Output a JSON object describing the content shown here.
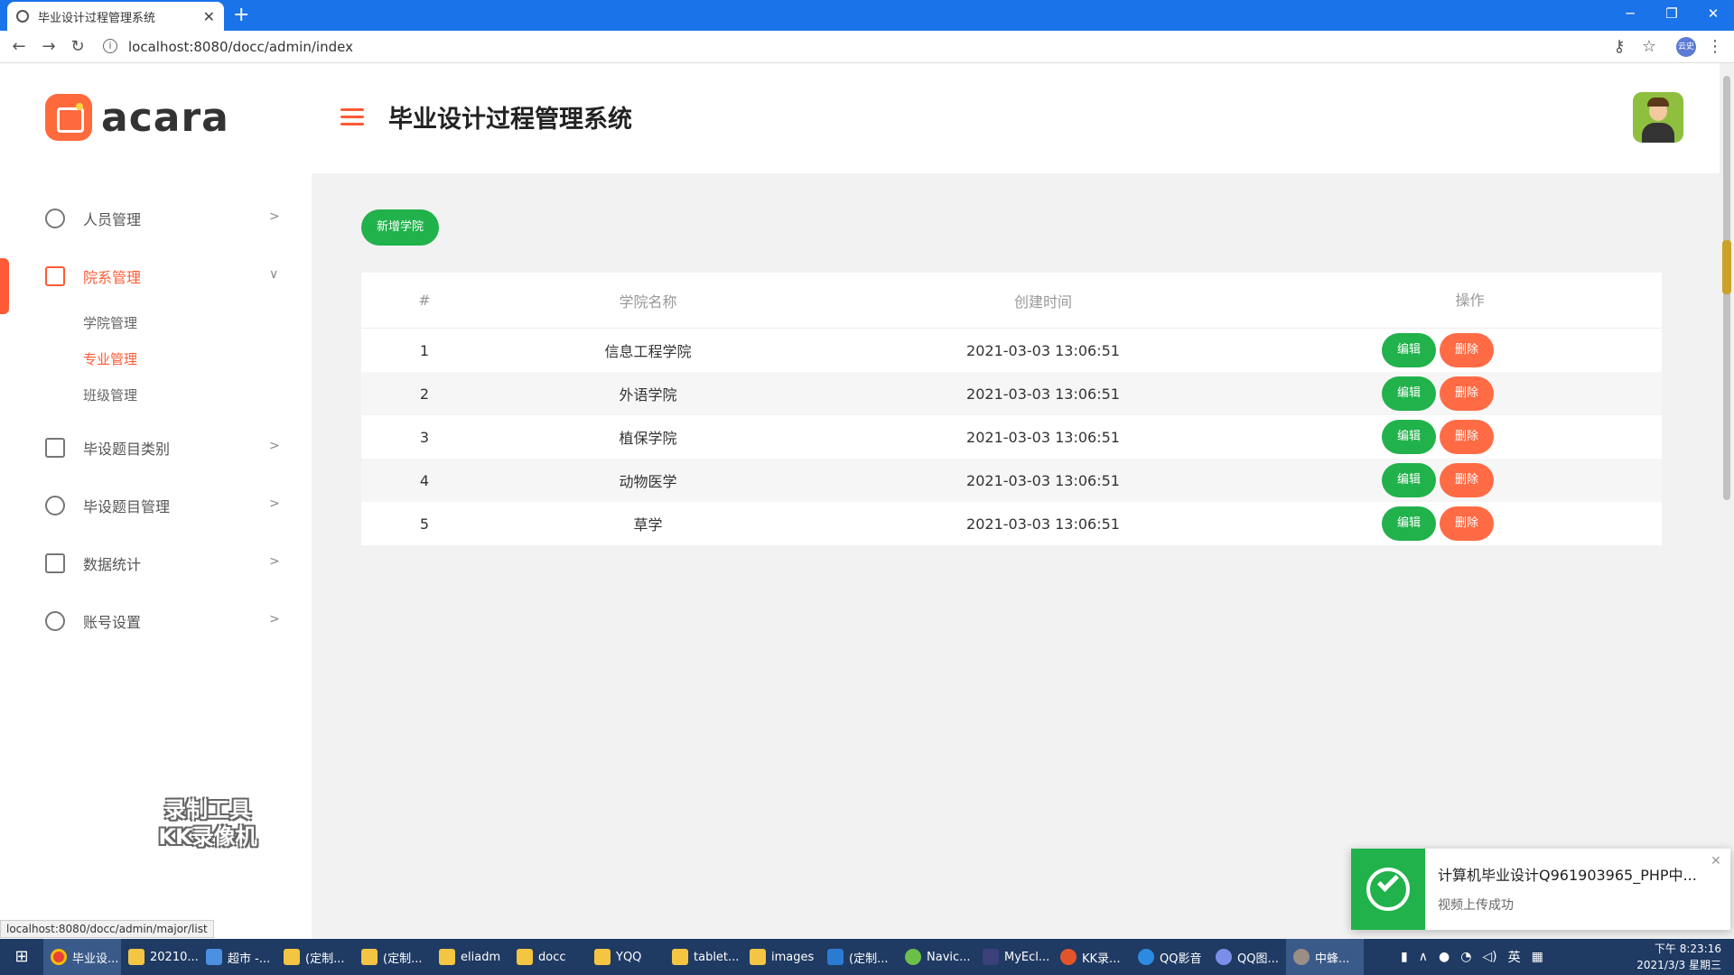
{
  "browser": {
    "tab_title": "毕业设计过程管理系统",
    "url": "localhost:8080/docc/admin/index",
    "status_url": "localhost:8080/docc/admin/major/list",
    "profile_label": "云史"
  },
  "app": {
    "logo_text": "acara",
    "page_title": "毕业设计过程管理系统"
  },
  "sidebar": {
    "items": [
      {
        "label": "人员管理",
        "icon": "user-icon"
      },
      {
        "label": "院系管理",
        "icon": "sliders-icon"
      },
      {
        "label": "毕设题目类别",
        "icon": "monitor-icon"
      },
      {
        "label": "毕设题目管理",
        "icon": "globe-icon"
      },
      {
        "label": "数据统计",
        "icon": "document-icon"
      },
      {
        "label": "账号设置",
        "icon": "gear-icon"
      }
    ],
    "submenu": [
      "学院管理",
      "专业管理",
      "班级管理"
    ]
  },
  "watermark": {
    "line1": "录制工具",
    "line2": "KK录像机"
  },
  "content": {
    "add_button": "新增学院",
    "table": {
      "headers": [
        "#",
        "学院名称",
        "创建时间",
        "操作"
      ],
      "rows": [
        {
          "id": "1",
          "name": "信息工程学院",
          "created": "2021-03-03 13:06:51"
        },
        {
          "id": "2",
          "name": "外语学院",
          "created": "2021-03-03 13:06:51"
        },
        {
          "id": "3",
          "name": "植保学院",
          "created": "2021-03-03 13:06:51"
        },
        {
          "id": "4",
          "name": "动物医学",
          "created": "2021-03-03 13:06:51"
        },
        {
          "id": "5",
          "name": "草学",
          "created": "2021-03-03 13:06:51"
        }
      ],
      "edit_label": "编辑",
      "delete_label": "删除"
    }
  },
  "toast": {
    "title": "计算机毕业设计Q961903965_PHP中...",
    "subtitle": "视频上传成功"
  },
  "taskbar": {
    "items": [
      "毕业设...",
      "20210...",
      "超市 -...",
      "(定制...",
      "(定制...",
      "eliadm",
      "docc",
      "YQQ",
      "tablet...",
      "images",
      "(定制...",
      "Navic...",
      "MyEcl...",
      "KK录...",
      "QQ影音",
      "QQ图...",
      "中蜂..."
    ],
    "ime": "英",
    "time": "下午 8:23:16",
    "date": "2021/3/3 星期三"
  },
  "colors": {
    "accent": "#ff5a36",
    "success": "#21b24b",
    "danger": "#ff6b45",
    "browser_blue": "#1a73e8"
  }
}
